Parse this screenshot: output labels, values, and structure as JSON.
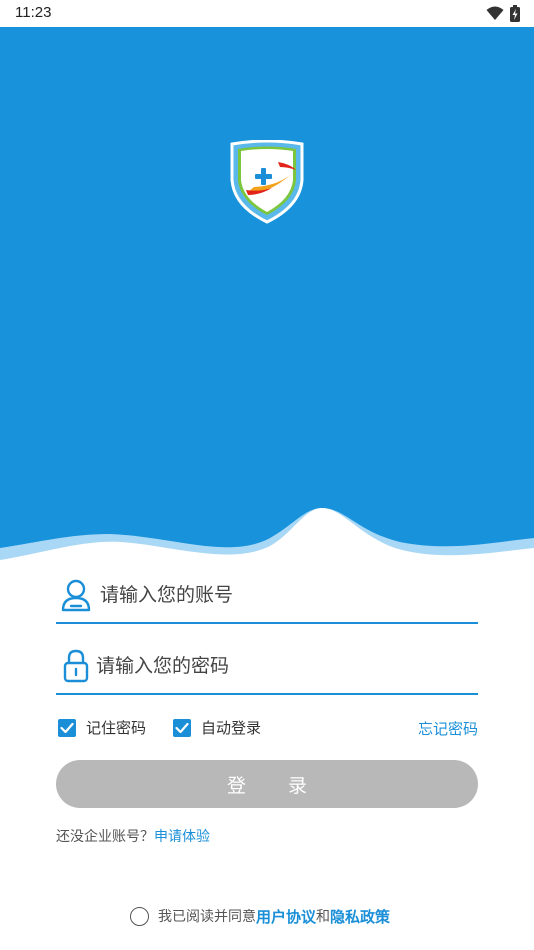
{
  "status_bar": {
    "time": "11:23",
    "icons": [
      "wifi-icon",
      "battery-charging-icon"
    ]
  },
  "colors": {
    "brand_blue": "#1792db",
    "accent": "#1a8fd8",
    "button_disabled": "#b8b8b8",
    "wave_light": "#a9d8f6"
  },
  "logo": {
    "icon": "shield-plus-logo"
  },
  "form": {
    "account": {
      "placeholder": "请输入您的账号",
      "value": "",
      "icon": "user-icon"
    },
    "password": {
      "placeholder": "请输入您的密码",
      "value": "",
      "icon": "lock-icon"
    },
    "remember_password": {
      "label": "记住密码",
      "checked": true
    },
    "auto_login": {
      "label": "自动登录",
      "checked": true
    },
    "forgot_password": "忘记密码",
    "login_button": "登 录"
  },
  "signup": {
    "prompt": "还没企业账号？",
    "link": "申请体验"
  },
  "agreement": {
    "checked": false,
    "prefix": "我已阅读并同意",
    "user_agreement": "用户协议",
    "and": "和",
    "privacy_policy": "隐私政策"
  }
}
